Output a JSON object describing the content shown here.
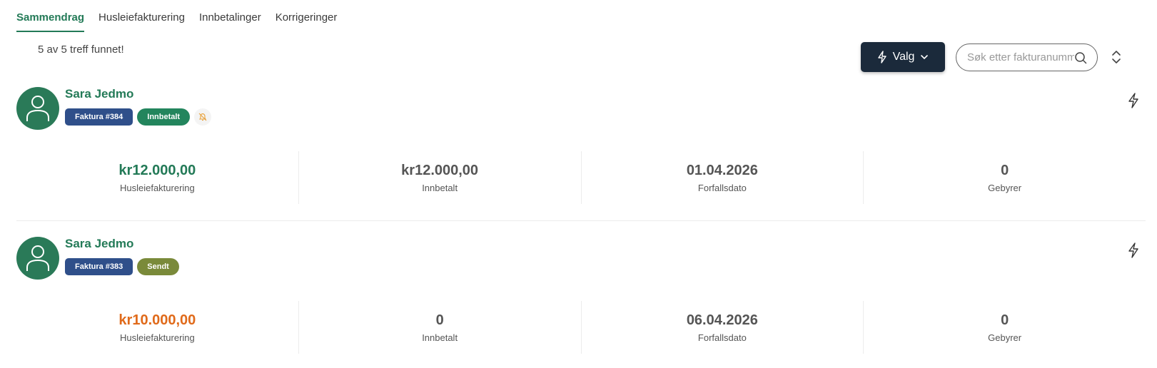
{
  "tabs": [
    {
      "label": "Sammendrag",
      "active": true
    },
    {
      "label": "Husleiefakturering",
      "active": false
    },
    {
      "label": "Innbetalinger",
      "active": false
    },
    {
      "label": "Korrigeringer",
      "active": false
    }
  ],
  "hits_text": "5 av 5 treff funnet!",
  "toolbar": {
    "valg_label": "Valg",
    "search_placeholder": "Søk etter fakturanummer"
  },
  "colors": {
    "accent": "#237a57",
    "invoice_badge": "#2f4f8a",
    "paid_badge": "#23855d",
    "sent_badge": "#7a8a3a",
    "amount_unpaid": "#e06a1a",
    "button_dark": "#1b2a3b"
  },
  "invoices": [
    {
      "name": "Sara Jedmo",
      "invoice_badge": "Faktura #384",
      "status_badge": "Innbetalt",
      "status_icon": "bell-off-icon",
      "stats": [
        {
          "value": "kr12.000,00",
          "label": "Husleiefakturering"
        },
        {
          "value": "kr12.000,00",
          "label": "Innbetalt"
        },
        {
          "value": "01.04.2026",
          "label": "Forfallsdato"
        },
        {
          "value": "0",
          "label": "Gebyrer"
        }
      ]
    },
    {
      "name": "Sara Jedmo",
      "invoice_badge": "Faktura #383",
      "status_badge": "Sendt",
      "stats": [
        {
          "value": "kr10.000,00",
          "label": "Husleiefakturering"
        },
        {
          "value": "0",
          "label": "Innbetalt"
        },
        {
          "value": "06.04.2026",
          "label": "Forfallsdato"
        },
        {
          "value": "0",
          "label": "Gebyrer"
        }
      ]
    }
  ]
}
